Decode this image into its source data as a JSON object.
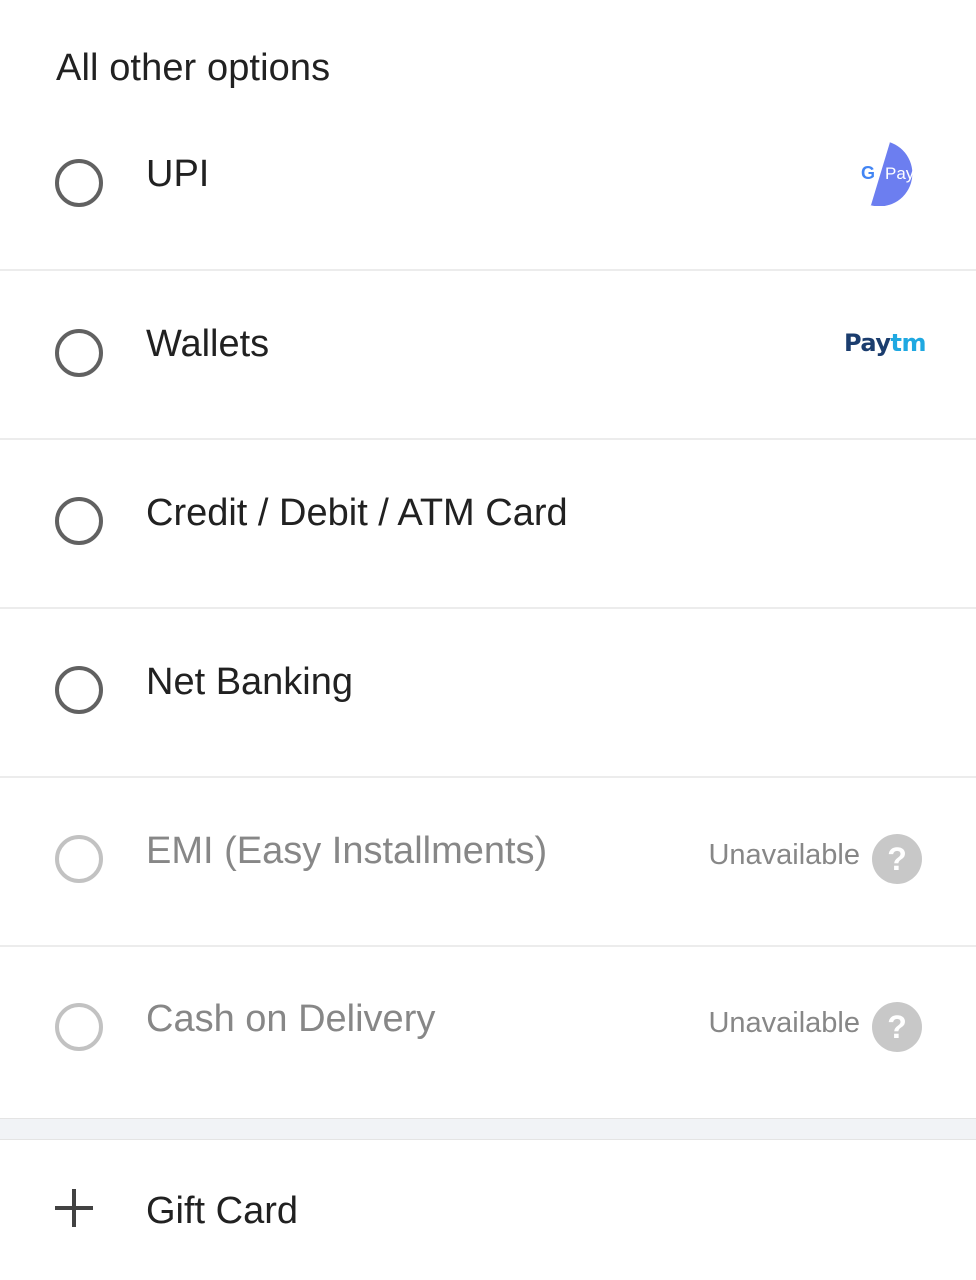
{
  "header": {
    "title": "All other options"
  },
  "options": [
    {
      "label": "UPI",
      "logo": "gpay-logo",
      "logo_text_g": "G",
      "logo_text_pay": "Pay",
      "available": true
    },
    {
      "label": "Wallets",
      "logo": "paytm-logo",
      "logo_text_pay": "Pay",
      "logo_text_tm": "tm",
      "available": true
    },
    {
      "label": "Credit / Debit / ATM Card",
      "available": true
    },
    {
      "label": "Net Banking",
      "available": true
    },
    {
      "label": "EMI (Easy Installments)",
      "available": false,
      "status": "Unavailable",
      "help_symbol": "?"
    },
    {
      "label": "Cash on Delivery",
      "available": false,
      "status": "Unavailable",
      "help_symbol": "?"
    }
  ],
  "gift_card": {
    "label": "Gift Card"
  },
  "colors": {
    "gpay_blue": "#6c7ef0",
    "paytm_dark": "#1b3d6e",
    "paytm_light": "#1fa8e1",
    "radio_enabled": "#616161",
    "radio_disabled": "#c2c2c2"
  }
}
